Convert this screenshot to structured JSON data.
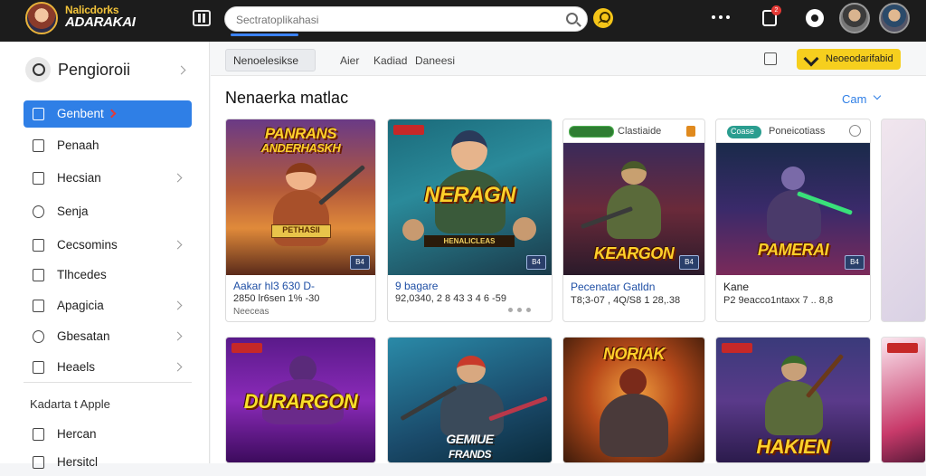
{
  "header": {
    "logo_line1": "Nalicdorks",
    "logo_line2": "ADARAKAI",
    "search_placeholder": "Sectratoplikahasi",
    "notification_count": "2"
  },
  "sidebar": {
    "search_label": "Pengioroii",
    "items": [
      {
        "label": "Genbent",
        "icon": "dashboard-icon",
        "active": true
      },
      {
        "label": "Penaah",
        "icon": "document-icon",
        "chevron": false
      },
      {
        "label": "Hecsian",
        "icon": "folder-icon",
        "chevron": true
      },
      {
        "label": "Senja",
        "icon": "clock-icon",
        "chevron": false
      },
      {
        "label": "Cecsomins",
        "icon": "lock-icon",
        "chevron": true
      },
      {
        "label": "Tlhcedes",
        "icon": "edit-icon",
        "chevron": false
      },
      {
        "label": "Apagicia",
        "icon": "clipboard-icon",
        "chevron": true
      },
      {
        "label": "Gbesatan",
        "icon": "gear-icon",
        "chevron": true
      },
      {
        "label": "Heaels",
        "icon": "mail-icon",
        "chevron": true
      }
    ],
    "section_label": "Kadarta t Apple",
    "section_items": [
      {
        "label": "Hercan",
        "icon": "calendar-icon"
      },
      {
        "label": "Hersitcl",
        "icon": "file-icon"
      }
    ]
  },
  "tabbar": {
    "main_tab": "Nenoelesikse",
    "links": [
      "Aier",
      "Kadiad",
      "Daneesi"
    ],
    "cta_label": "Neoeodarifabid"
  },
  "section": {
    "title": "Nenaerka matlac",
    "link": "Cam"
  },
  "cards_row1": [
    {
      "art_title_1": "PANRANS",
      "art_title_2": "ANDERHASKH",
      "banner": "PETHASII",
      "tag": "B4",
      "title": "Aakar hl3 630 D-",
      "sub": "2850 lr6sen 1% -30",
      "sub2": "Neeceas"
    },
    {
      "art_title_1": "NERAGN",
      "art_title_2": "",
      "banner": "HENALICLEAS",
      "tag": "B4",
      "title": "9 bagare",
      "sub": "92,0340, 2 8 43 3 4 6 -59",
      "sub2": ""
    },
    {
      "strip_label": "Clastiaide",
      "art_title_1": "KEARGON",
      "art_title_2": "",
      "tag": "B4",
      "title": "Pecenatar Gatldn",
      "sub": "T8;3-07 , 4Q/S8 1 28,.38",
      "sub2": ""
    },
    {
      "strip_pill": "Coase",
      "strip_label": "Poneicotiass",
      "art_title_1": "PAMERAI",
      "art_title_2": "",
      "tag": "B4",
      "title": "Kane",
      "sub": "P2 9eacco1ntaxx 7 .. 8,8",
      "sub2": ""
    }
  ],
  "cards_row2": [
    {
      "art_title_1": "DURARGON",
      "art_title_2": ""
    },
    {
      "art_title_1": "GEMIUE",
      "art_title_2": "FRANDS"
    },
    {
      "art_title_1": "NORIAK",
      "art_title_2": ""
    },
    {
      "art_title_1": "HAKIEN",
      "art_title_2": ""
    }
  ],
  "colors": {
    "accent": "#2f7fe6",
    "cta": "#f6cf1e",
    "topbar": "#1c1c1c"
  }
}
